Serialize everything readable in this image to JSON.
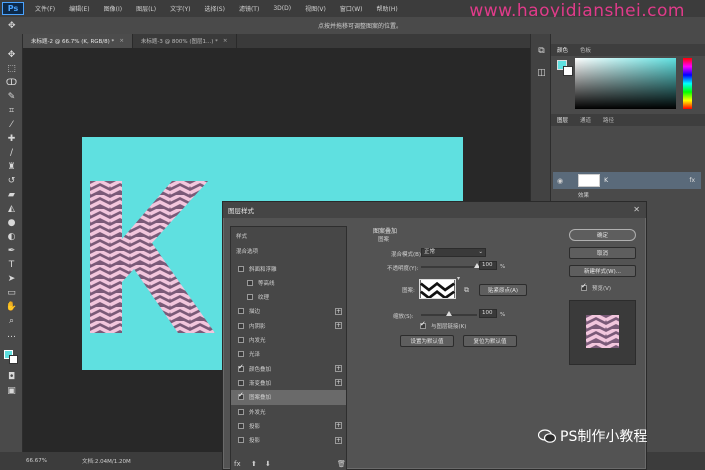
{
  "app": {
    "logo": "Ps"
  },
  "watermark": {
    "url": "www.haoyidianshei.com",
    "wechat_name": "PS制作小教程"
  },
  "menu": [
    "文件(F)",
    "编辑(E)",
    "图像(I)",
    "图层(L)",
    "文字(Y)",
    "选择(S)",
    "滤镜(T)",
    "3D(D)",
    "视图(V)",
    "窗口(W)",
    "帮助(H)"
  ],
  "options": {
    "hint": "点按并拖移可调整图案的位置。"
  },
  "doc_tabs": [
    {
      "label": "未标题-2 @ 66.7% (K, RGB/8) *",
      "active": true
    },
    {
      "label": "未标题-3 @ 800% (图层1...) *",
      "active": false
    }
  ],
  "status": {
    "zoom": "66.67%",
    "doc": "文档:2.04M/1.20M"
  },
  "panels": {
    "color_tabs": [
      "颜色",
      "色板"
    ],
    "layer_tabs": [
      "图层",
      "通道",
      "路径"
    ],
    "layer_name": "K",
    "layer_effects": "效果"
  },
  "dialog": {
    "title": "图层样式",
    "styles_header": "样式",
    "blend_options": "混合选项",
    "styles": [
      {
        "label": "斜面和浮雕",
        "checked": false,
        "plus": false,
        "indent": false
      },
      {
        "label": "等高线",
        "checked": false,
        "plus": false,
        "indent": true
      },
      {
        "label": "纹理",
        "checked": false,
        "plus": false,
        "indent": true
      },
      {
        "label": "描边",
        "checked": false,
        "plus": true,
        "indent": false
      },
      {
        "label": "内阴影",
        "checked": false,
        "plus": true,
        "indent": false
      },
      {
        "label": "内发光",
        "checked": false,
        "plus": false,
        "indent": false
      },
      {
        "label": "光泽",
        "checked": false,
        "plus": false,
        "indent": false
      },
      {
        "label": "颜色叠加",
        "checked": true,
        "plus": true,
        "indent": false
      },
      {
        "label": "渐变叠加",
        "checked": false,
        "plus": true,
        "indent": false
      },
      {
        "label": "图案叠加",
        "checked": true,
        "plus": false,
        "indent": false,
        "selected": true
      },
      {
        "label": "外发光",
        "checked": false,
        "plus": false,
        "indent": false
      },
      {
        "label": "投影",
        "checked": false,
        "plus": true,
        "indent": false
      },
      {
        "label": "投影",
        "checked": false,
        "plus": true,
        "indent": false
      }
    ],
    "section_title": "图案叠加",
    "section_sub": "图案",
    "blend_mode_label": "混合模式(B):",
    "blend_mode_value": "正常",
    "opacity_label": "不透明度(Y):",
    "opacity_value": "100",
    "percent": "%",
    "pattern_label": "图案:",
    "snap_button": "贴紧原点(A)",
    "scale_label": "缩放(S):",
    "scale_value": "100",
    "link_label": "与图层链接(K)",
    "link_checked": true,
    "set_default": "设置为默认值",
    "reset_default": "复位为默认值",
    "ok": "确定",
    "cancel": "取消",
    "new_style": "新建样式(W)...",
    "preview_label": "预览(V)",
    "preview_checked": true,
    "opacity_fraction": 1.0,
    "scale_fraction": 0.5
  },
  "colors": {
    "canvas": "#5fe0e0",
    "pattern_pink": "#f2c6dd",
    "pattern_purple": "#7a5a78"
  }
}
